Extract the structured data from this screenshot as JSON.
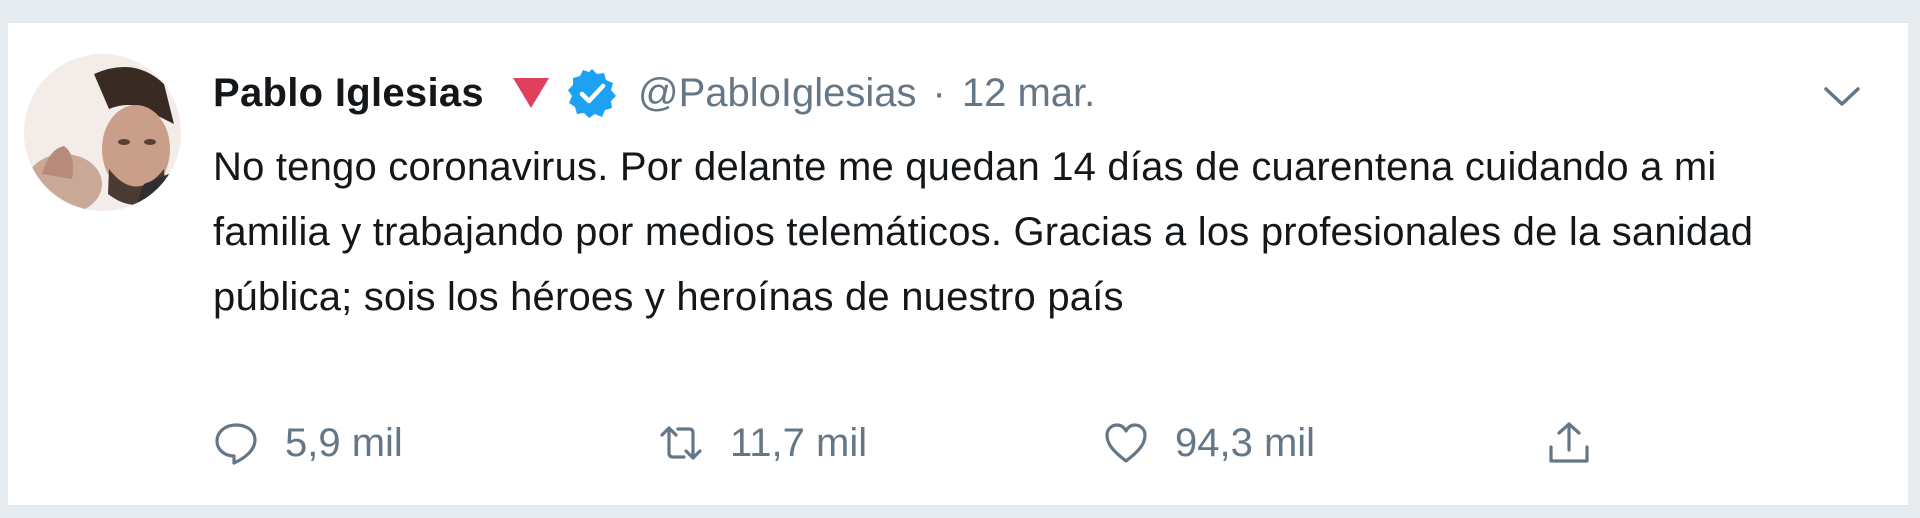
{
  "tweet": {
    "author_name": "Pablo Iglesias",
    "handle": "@PabloIglesias",
    "separator": "·",
    "date": "12 mar.",
    "text": "No tengo coronavirus. Por delante me quedan 14 días de cuarentena cuidando a mi familia y trabajando por medios telemáticos. Gracias a los profesionales de la sanidad pública; sois los héroes y heroínas de nuestro país",
    "replies": "5,9 mil",
    "retweets": "11,7 mil",
    "likes": "94,3 mil"
  },
  "icons": {
    "party_badge": "red-triangle-rose-icon",
    "verified": "verified-badge-icon",
    "menu": "chevron-down-icon",
    "reply": "reply-icon",
    "retweet": "retweet-icon",
    "like": "heart-icon",
    "share": "share-icon"
  },
  "colors": {
    "name": "#14171a",
    "secondary": "#657786",
    "verified": "#1da1f2",
    "party_badge": "#e0405e",
    "background": "#e6ecf0",
    "card": "#ffffff"
  }
}
